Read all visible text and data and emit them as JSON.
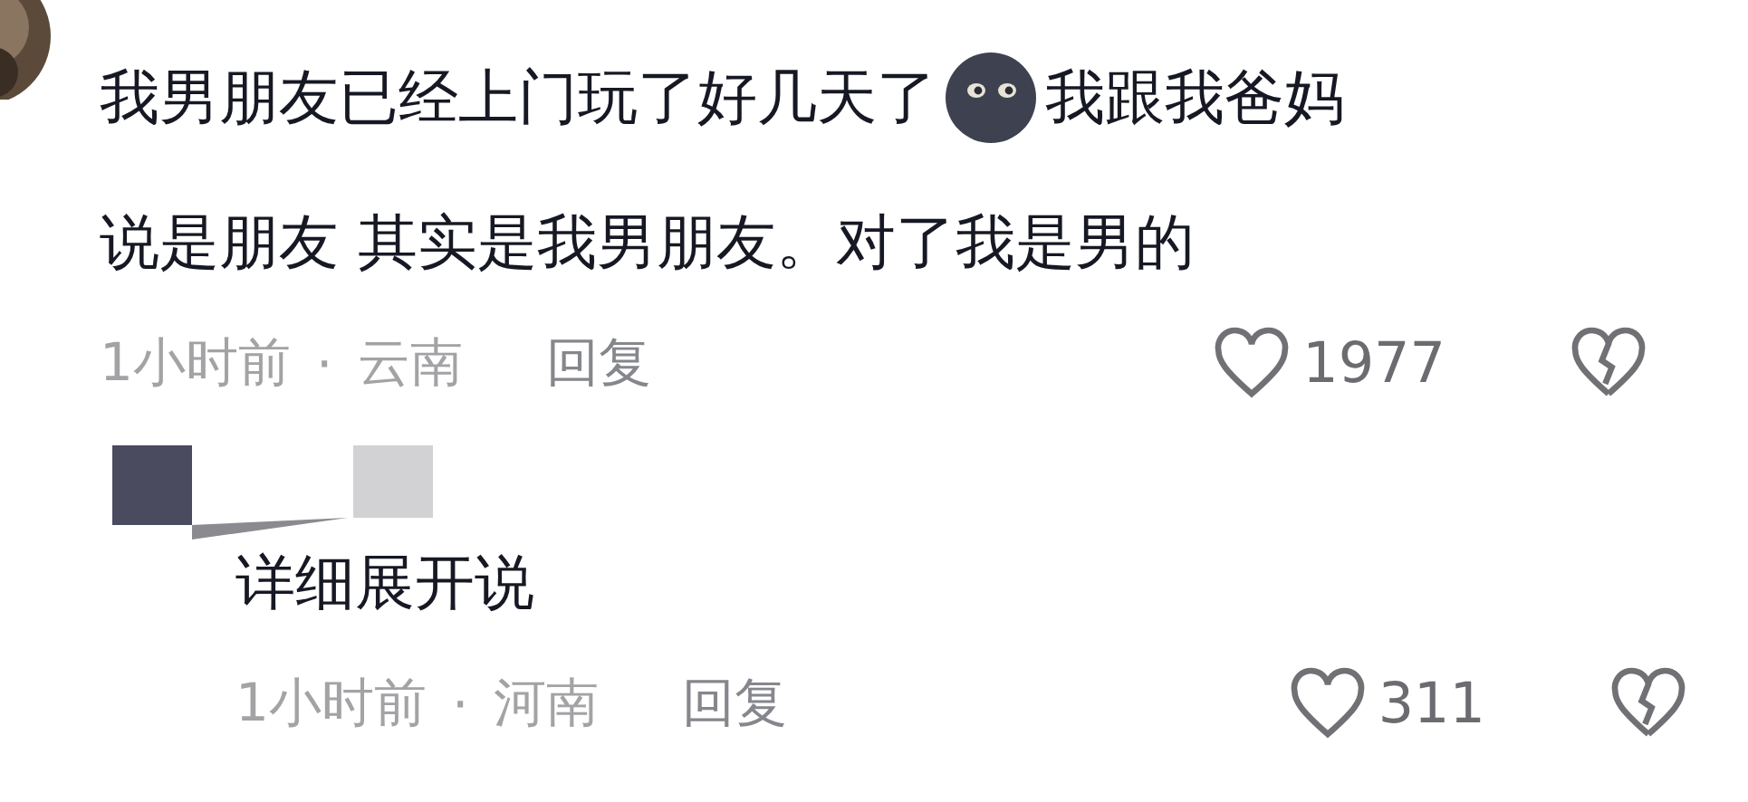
{
  "comments": [
    {
      "text_lines": [
        "我男朋友已经上门玩了好几天了",
        "我跟我爸妈",
        "说是朋友 其实是我男朋友。对了我是男的"
      ],
      "time": "1小时前",
      "separator": "·",
      "location": "云南",
      "reply": "回复",
      "likes": "1977"
    },
    {
      "text_lines": [
        "详细展开说"
      ],
      "time": "1小时前",
      "separator": "·",
      "location": "河南",
      "reply": "回复",
      "likes": "311"
    }
  ]
}
